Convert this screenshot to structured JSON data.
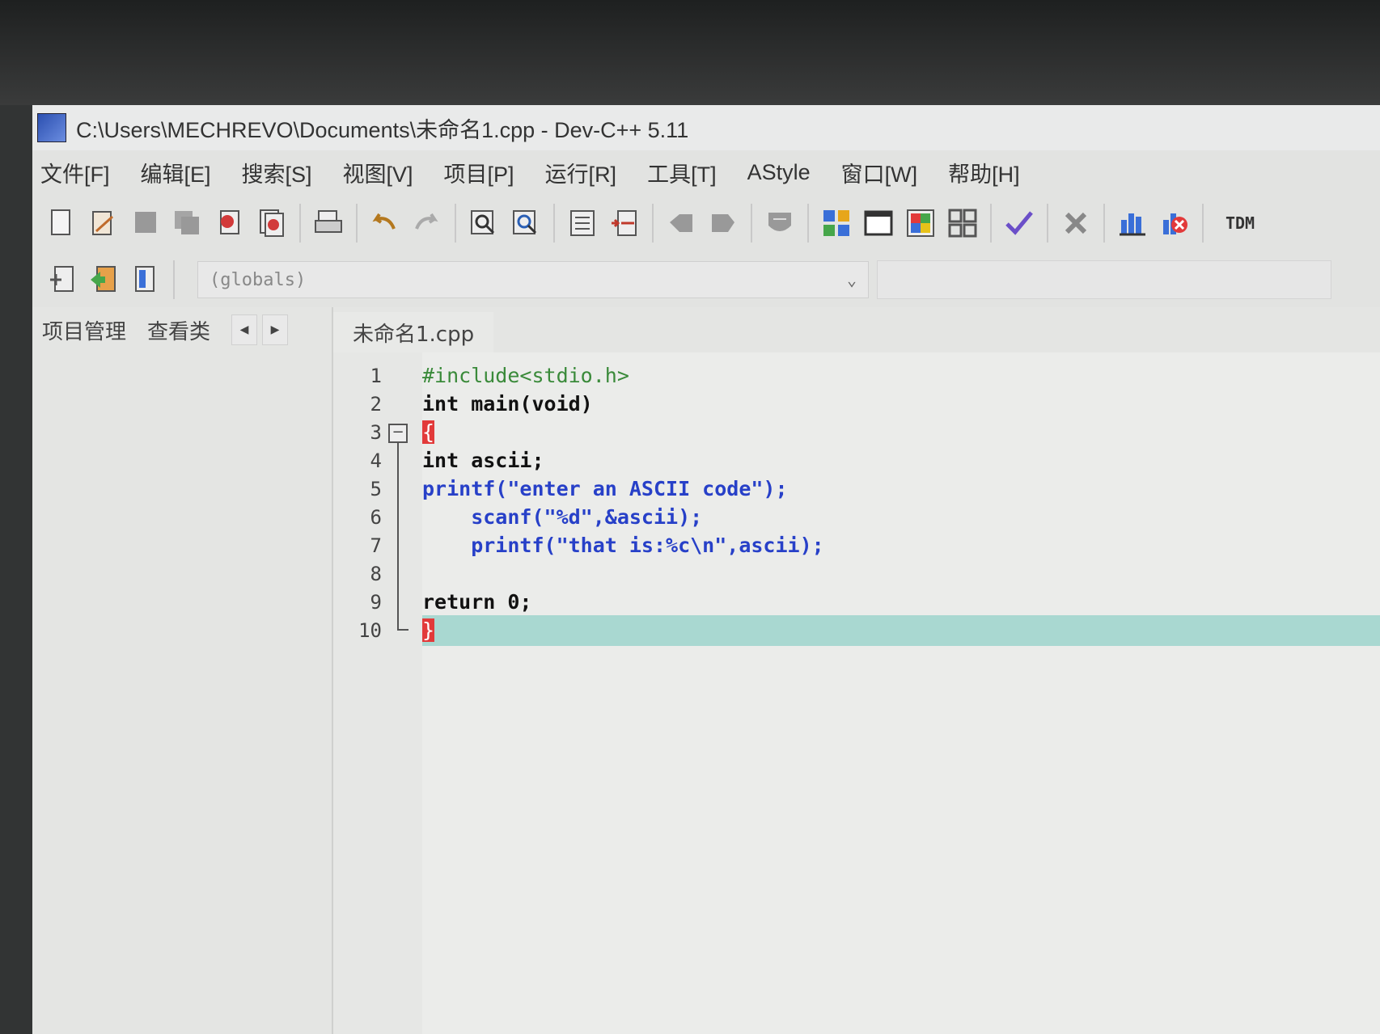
{
  "window": {
    "title": "C:\\Users\\MECHREVO\\Documents\\未命名1.cpp - Dev-C++ 5.11"
  },
  "menu": [
    "文件[F]",
    "编辑[E]",
    "搜索[S]",
    "视图[V]",
    "项目[P]",
    "运行[R]",
    "工具[T]",
    "AStyle",
    "窗口[W]",
    "帮助[H]"
  ],
  "toolbar": {
    "scope_combo": "(globals)",
    "tdm_label": "TDM"
  },
  "left_panel": {
    "tabs": [
      "项目管理",
      "查看类"
    ]
  },
  "editor": {
    "file_tab": "未命名1.cpp",
    "line_numbers": [
      "1",
      "2",
      "3",
      "4",
      "5",
      "6",
      "7",
      "8",
      "9",
      "10"
    ],
    "code": [
      "#include<stdio.h>",
      "int main(void)",
      "{",
      "int ascii;",
      "printf(\"enter an ASCII code\");",
      "    scanf(\"%d\",&ascii);",
      "    printf(\"that is:%c\\n\",ascii);",
      "",
      "return 0;",
      "}"
    ]
  },
  "colors": {
    "current_line_highlight": "#a9d8d1",
    "brace_match": "#e23a3a",
    "string": "#2740c8",
    "preprocessor": "#3a8a3a"
  }
}
